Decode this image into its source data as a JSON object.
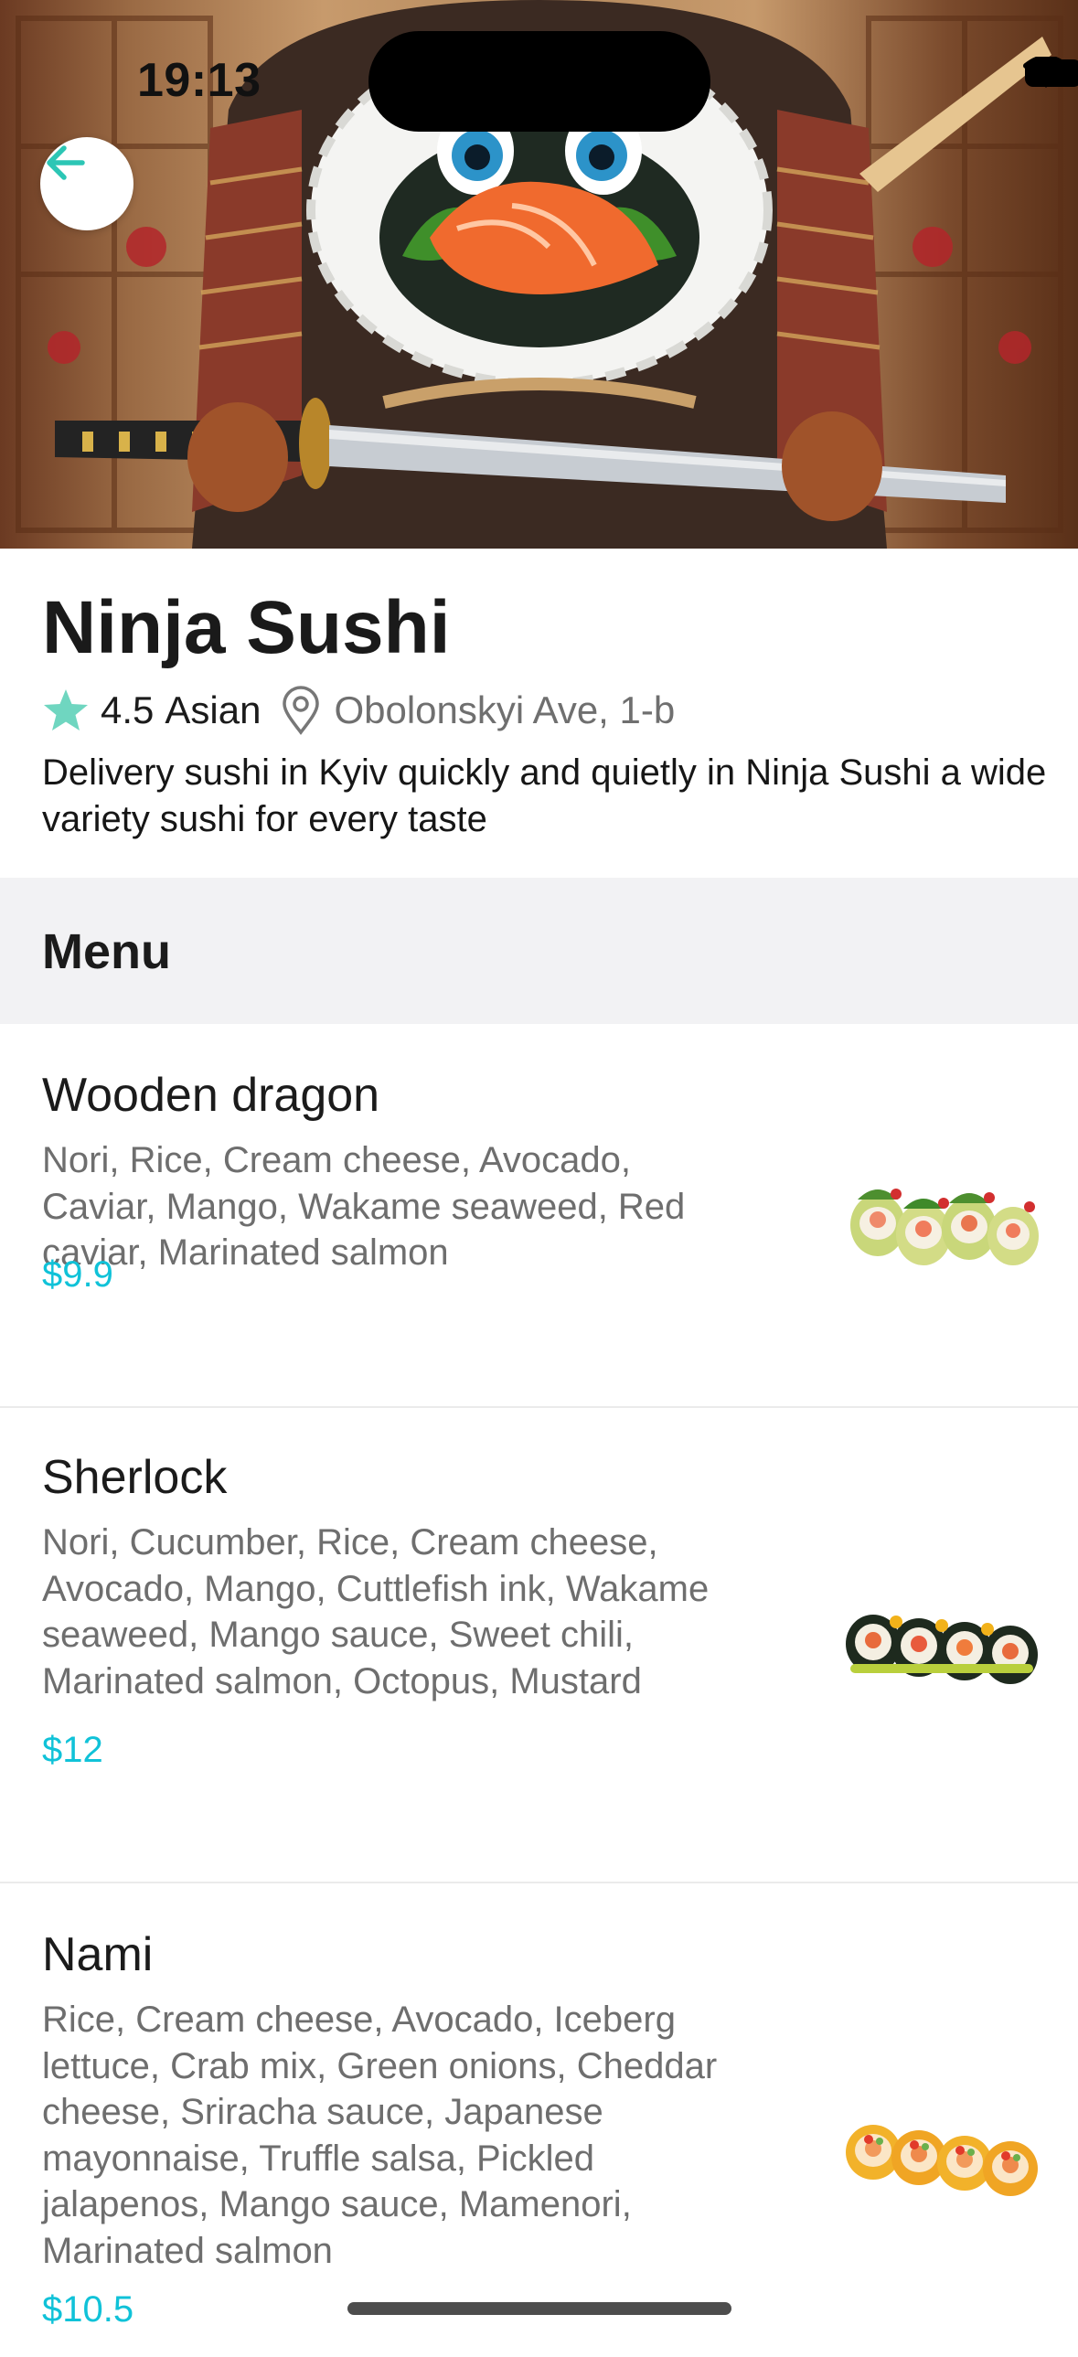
{
  "status_bar": {
    "time": "19:13"
  },
  "restaurant": {
    "name": "Ninja Sushi",
    "rating": "4.5",
    "cuisine": "Asian",
    "address": "Obolonskyi Ave, 1-b",
    "description": "Delivery sushi in Kyiv quickly and quietly in Ninja Sushi a wide variety sushi for every taste"
  },
  "menu": {
    "title": "Menu",
    "items": [
      {
        "name": "Wooden dragon",
        "ingredients": "Nori, Rice, Cream cheese, Avocado, Caviar, Mango, Wakame seaweed, Red caviar, Marinated salmon",
        "price": "$9.9"
      },
      {
        "name": "Sherlock",
        "ingredients": "Nori, Cucumber, Rice, Cream cheese, Avocado, Mango, Cuttlefish ink, Wakame seaweed, Mango sauce, Sweet chili, Marinated salmon, Octopus, Mustard",
        "price": "$12"
      },
      {
        "name": "Nami",
        "ingredients": "Rice, Cream cheese, Avocado, Iceberg lettuce, Crab mix, Green onions, Cheddar cheese, Sriracha sauce, Japanese mayonnaise, Truffle salsa, Pickled jalapenos, Mango sauce, Mamenori, Marinated salmon",
        "price": "$10.5"
      }
    ]
  },
  "colors": {
    "accent": "#10c2d8",
    "star": "#6fd6c0",
    "back_arrow": "#2cc6b5",
    "section_bg": "#f2f2f4"
  },
  "icons": {
    "back": "arrow-left-icon",
    "rating": "star-icon",
    "location": "map-pin-icon",
    "wifi": "wifi-icon",
    "battery": "battery-icon"
  }
}
